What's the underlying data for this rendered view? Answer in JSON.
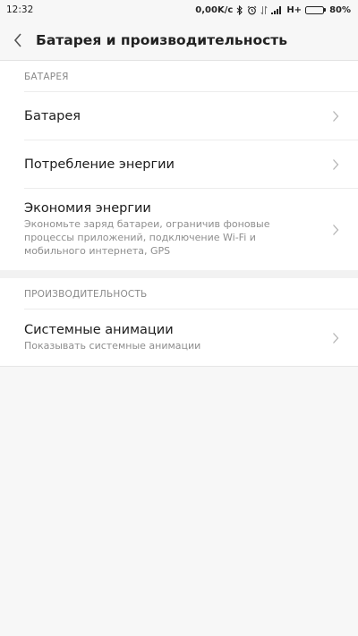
{
  "status_bar": {
    "time": "12:32",
    "speed": "0,00K/c",
    "network": "H+",
    "battery": "80%",
    "battery_level": 0.8,
    "icons": [
      "bluetooth-icon",
      "alarm-icon",
      "data-transfer-icon",
      "signal-icon",
      "battery-icon"
    ]
  },
  "header": {
    "title": "Батарея и производительность",
    "back_icon": "chevron-left-icon"
  },
  "sections": [
    {
      "header": "БАТАРЕЯ",
      "items": [
        {
          "title": "Батарея"
        },
        {
          "title": "Потребление энергии"
        },
        {
          "title": "Экономия энергии",
          "subtitle": "Экономьте заряд батареи, ограничив фоновые процессы приложений, подключение Wi-Fi и мобильного интернета, GPS"
        }
      ]
    },
    {
      "header": "ПРОИЗВОДИТЕЛЬНОСТЬ",
      "items": [
        {
          "title": "Системные анимации",
          "subtitle": "Показывать системные анимации"
        }
      ]
    }
  ],
  "colors": {
    "background": "#f7f7f7",
    "card": "#ffffff",
    "section_header": "#8a8a8a",
    "subtitle": "#8e8e8e",
    "chevron": "#b5b5b5"
  }
}
